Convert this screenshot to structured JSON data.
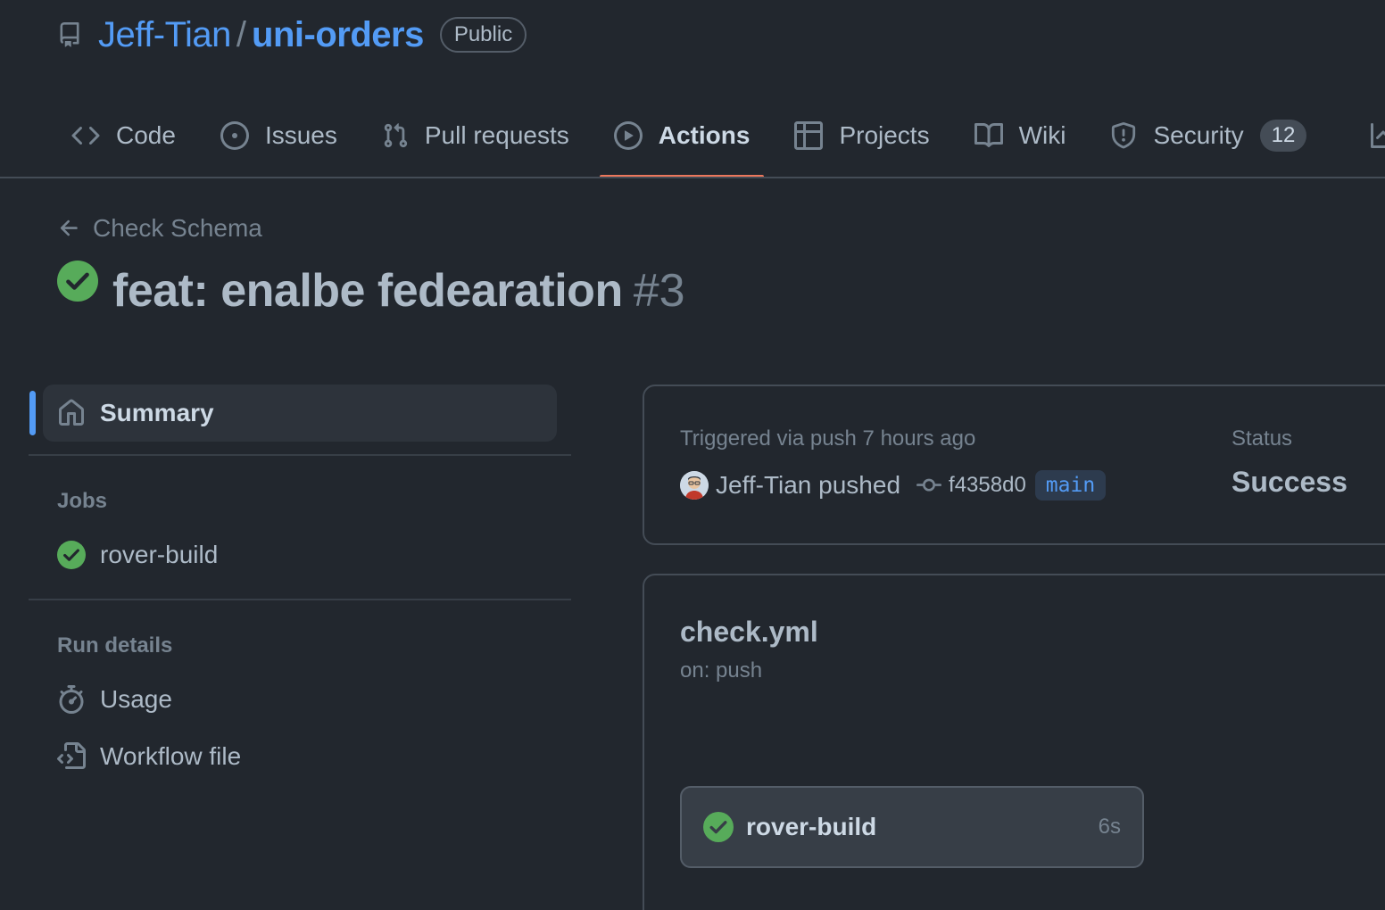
{
  "repo": {
    "owner": "Jeff-Tian",
    "separator": "/",
    "name": "uni-orders",
    "visibility": "Public"
  },
  "nav": {
    "items": [
      {
        "label": "Code",
        "icon": "code-icon"
      },
      {
        "label": "Issues",
        "icon": "issue-opened-icon"
      },
      {
        "label": "Pull requests",
        "icon": "git-pull-request-icon"
      },
      {
        "label": "Actions",
        "icon": "play-icon",
        "active": true
      },
      {
        "label": "Projects",
        "icon": "table-icon"
      },
      {
        "label": "Wiki",
        "icon": "book-icon"
      },
      {
        "label": "Security",
        "icon": "shield-icon",
        "counter": "12"
      }
    ]
  },
  "run": {
    "back_label": "Check Schema",
    "title": "feat: enalbe fedearation",
    "number": "#3",
    "status_color": "#57ab5a"
  },
  "sidebar": {
    "summary_label": "Summary",
    "jobs_heading": "Jobs",
    "jobs": [
      {
        "label": "rover-build"
      }
    ],
    "run_details_heading": "Run details",
    "details": [
      {
        "label": "Usage",
        "icon": "stopwatch-icon"
      },
      {
        "label": "Workflow file",
        "icon": "file-code-icon"
      }
    ]
  },
  "summary_card": {
    "trigger_text": "Triggered via push 7 hours ago",
    "actor_text": "Jeff-Tian pushed",
    "commit_sha": "f4358d0",
    "branch": "main",
    "status_label": "Status",
    "status_value": "Success"
  },
  "workflow_card": {
    "file_name": "check.yml",
    "trigger": "on: push",
    "job": {
      "name": "rover-build",
      "duration": "6s"
    }
  },
  "colors": {
    "accent": "#539bf5",
    "tab_underline": "#ec775c",
    "success": "#57ab5a",
    "background": "#22272e"
  }
}
